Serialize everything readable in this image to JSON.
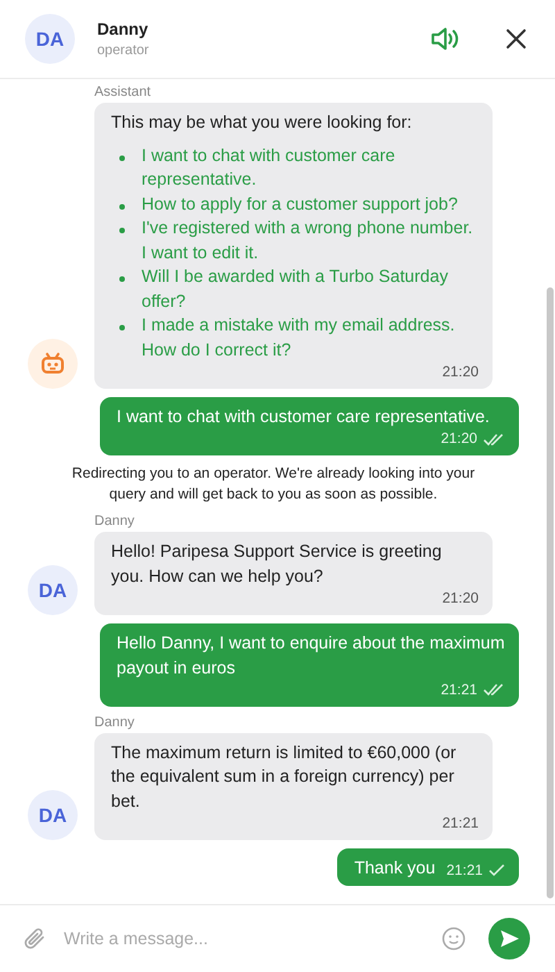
{
  "header": {
    "avatar": "DA",
    "name": "Danny",
    "role": "operator"
  },
  "messages": [
    {
      "kind": "options",
      "sender": "Assistant",
      "intro": "This may be what you were looking for:",
      "options": [
        "I want to chat with customer care representative.",
        "How to apply for a customer support job?",
        "I've registered with a wrong phone number. I want to edit it.",
        "Will I be awarded with a Turbo Saturday offer?",
        "I made a mistake with my email address. How do I correct it?"
      ],
      "time": "21:20"
    },
    {
      "kind": "outgoing",
      "text": "I want to chat with customer care representative.",
      "time": "21:20",
      "read": true
    },
    {
      "kind": "system",
      "text": "Redirecting you to an operator. We're already looking into your query and will get back to you as soon as possible."
    },
    {
      "kind": "incoming",
      "sender": "Danny",
      "avatar": "DA",
      "text": "Hello! Paripesa Support Service is greeting you. How can we help you?",
      "time": "21:20"
    },
    {
      "kind": "outgoing",
      "text": "Hello Danny, I want to enquire about the maximum payout in euros",
      "time": "21:21",
      "read": true
    },
    {
      "kind": "incoming",
      "sender": "Danny",
      "avatar": "DA",
      "text": "The maximum return is limited to €60,000 (or the equivalent sum in a foreign currency) per bet.",
      "time": "21:21"
    },
    {
      "kind": "outgoing",
      "text": "Thank you",
      "time": "21:21",
      "read": false
    }
  ],
  "composer": {
    "placeholder": "Write a message..."
  }
}
